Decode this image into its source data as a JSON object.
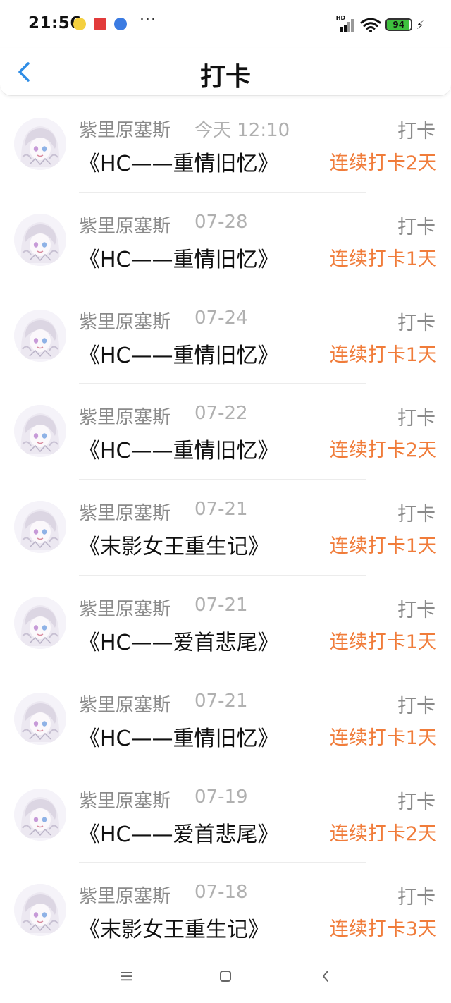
{
  "status_bar": {
    "time": "21:56",
    "network_badge": "HD",
    "battery_level": "94",
    "battery_fraction": 0.94,
    "icons": [
      "notification-app-icon",
      "notification-app-icon",
      "notification-app-icon",
      "more-dots-icon",
      "signal-icon",
      "wifi-icon",
      "battery-icon",
      "charging-bolt-icon"
    ],
    "more": "···"
  },
  "header": {
    "title": "打卡",
    "back_icon": "chevron-left-icon"
  },
  "colors": {
    "accent": "#2f8de6",
    "streak": "#f07c3a",
    "muted": "#8a8a8a"
  },
  "entries": [
    {
      "name": "紫里原塞斯",
      "time": "今天 12:10",
      "tag": "打卡",
      "title": "《HC——重情旧忆》",
      "streak": "连续打卡2天"
    },
    {
      "name": "紫里原塞斯",
      "time": "07-28",
      "tag": "打卡",
      "title": "《HC——重情旧忆》",
      "streak": "连续打卡1天"
    },
    {
      "name": "紫里原塞斯",
      "time": "07-24",
      "tag": "打卡",
      "title": "《HC——重情旧忆》",
      "streak": "连续打卡1天"
    },
    {
      "name": "紫里原塞斯",
      "time": "07-22",
      "tag": "打卡",
      "title": "《HC——重情旧忆》",
      "streak": "连续打卡2天"
    },
    {
      "name": "紫里原塞斯",
      "time": "07-21",
      "tag": "打卡",
      "title": "《末影女王重生记》",
      "streak": "连续打卡1天"
    },
    {
      "name": "紫里原塞斯",
      "time": "07-21",
      "tag": "打卡",
      "title": "《HC——爱首悲尾》",
      "streak": "连续打卡1天"
    },
    {
      "name": "紫里原塞斯",
      "time": "07-21",
      "tag": "打卡",
      "title": "《HC——重情旧忆》",
      "streak": "连续打卡1天"
    },
    {
      "name": "紫里原塞斯",
      "time": "07-19",
      "tag": "打卡",
      "title": "《HC——爱首悲尾》",
      "streak": "连续打卡2天"
    },
    {
      "name": "紫里原塞斯",
      "time": "07-18",
      "tag": "打卡",
      "title": "《末影女王重生记》",
      "streak": "连续打卡3天"
    }
  ],
  "bottom_nav": [
    "menu-icon",
    "home-square-icon",
    "back-chevron-icon"
  ]
}
